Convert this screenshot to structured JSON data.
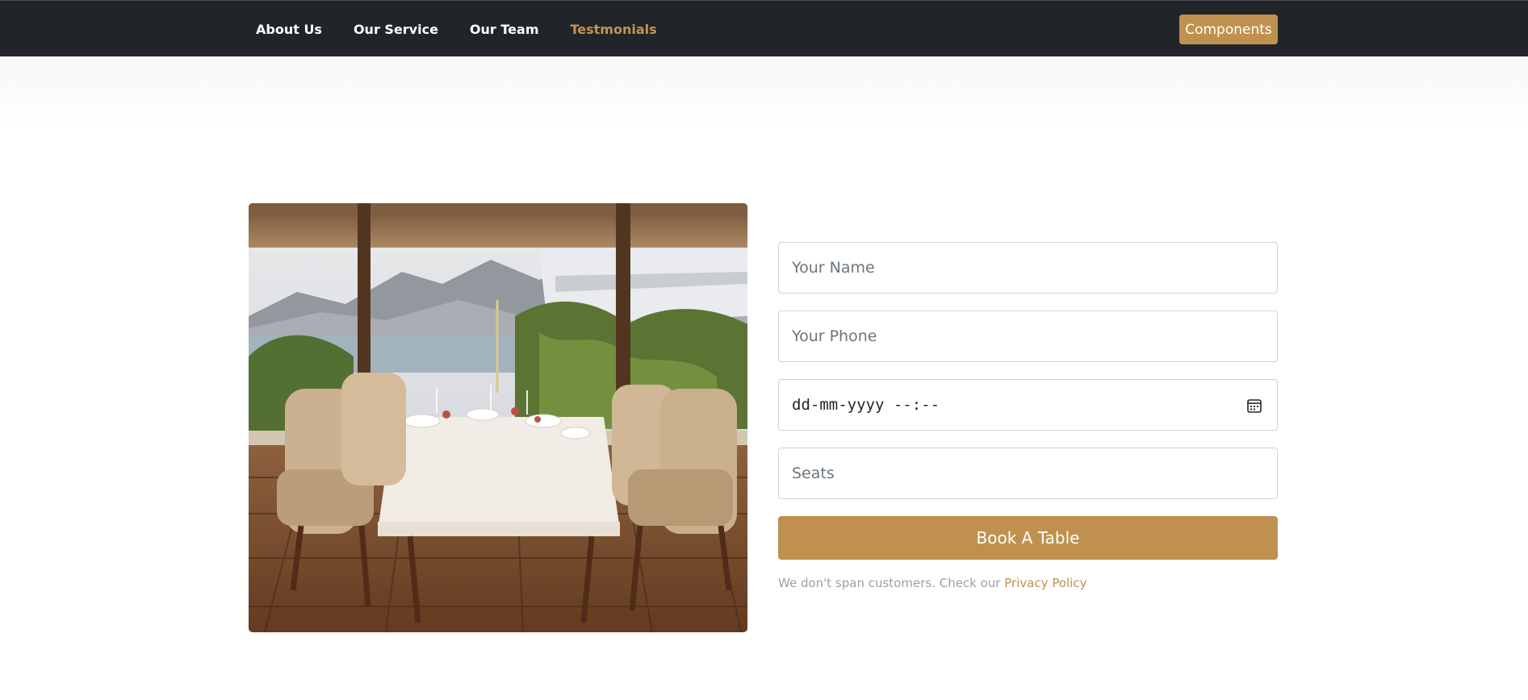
{
  "nav": {
    "links": [
      "About Us",
      "Our Service",
      "Our Team",
      "Testmonials"
    ],
    "active_index": 3,
    "components_label": "Components"
  },
  "booking": {
    "name_placeholder": "Your Name",
    "phone_placeholder": "Your Phone",
    "datetime_value": "dd-mm-yyyy --:--",
    "seats_placeholder": "Seats",
    "submit_label": "Book A Table",
    "note_text": "We don't span customers. Check our ",
    "privacy_link": "Privacy Policy"
  },
  "colors": {
    "navbar_bg": "#212529",
    "accent": "#c0914e",
    "active_link": "#c59453"
  },
  "icons": {
    "date_picker": "calendar-icon"
  }
}
